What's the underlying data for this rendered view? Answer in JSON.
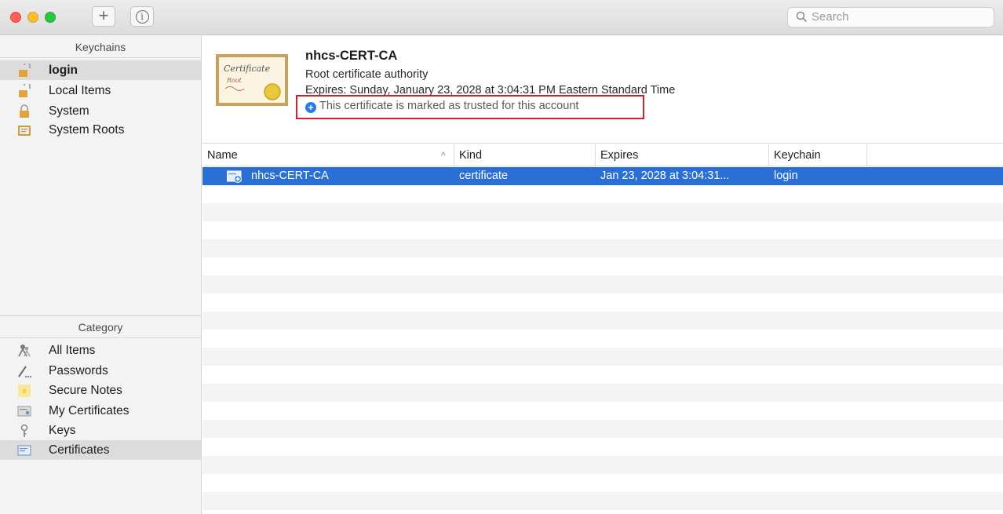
{
  "toolbar": {
    "add_label": "+",
    "info_label": "i",
    "search_placeholder": "Search"
  },
  "sidebar": {
    "keychains_header": "Keychains",
    "keychains": [
      {
        "label": "login",
        "icon": "open-lock-icon",
        "selected": true
      },
      {
        "label": "Local Items",
        "icon": "open-lock-icon"
      },
      {
        "label": "System",
        "icon": "lock-icon"
      },
      {
        "label": "System Roots",
        "icon": "certificate-folder-icon"
      }
    ],
    "category_header": "Category",
    "categories": [
      {
        "label": "All Items",
        "icon": "people-icon"
      },
      {
        "label": "Passwords",
        "icon": "pencil-dots-icon"
      },
      {
        "label": "Secure Notes",
        "icon": "note-icon"
      },
      {
        "label": "My Certificates",
        "icon": "my-certificate-icon"
      },
      {
        "label": "Keys",
        "icon": "key-icon"
      },
      {
        "label": "Certificates",
        "icon": "certificate-icon",
        "selected": true
      }
    ]
  },
  "details": {
    "thumbnail_text": "Certificate",
    "thumbnail_subtext": "Root",
    "name": "nhcs-CERT-CA",
    "type": "Root certificate authority",
    "expires": "Expires: Sunday, January 23, 2028 at 3:04:31 PM Eastern Standard Time",
    "trust_status": "This certificate is marked as trusted for this account"
  },
  "table": {
    "columns": [
      "Name",
      "Kind",
      "Expires",
      "Keychain"
    ],
    "sort_indicator": "^",
    "rows": [
      {
        "name": "nhcs-CERT-CA",
        "kind": "certificate",
        "expires": "Jan 23, 2028 at 3:04:31...",
        "keychain": "login"
      }
    ]
  },
  "colors": {
    "selection": "#2a6fd6",
    "highlight_box": "#d0212b",
    "trust_icon": "#2a7be4"
  }
}
